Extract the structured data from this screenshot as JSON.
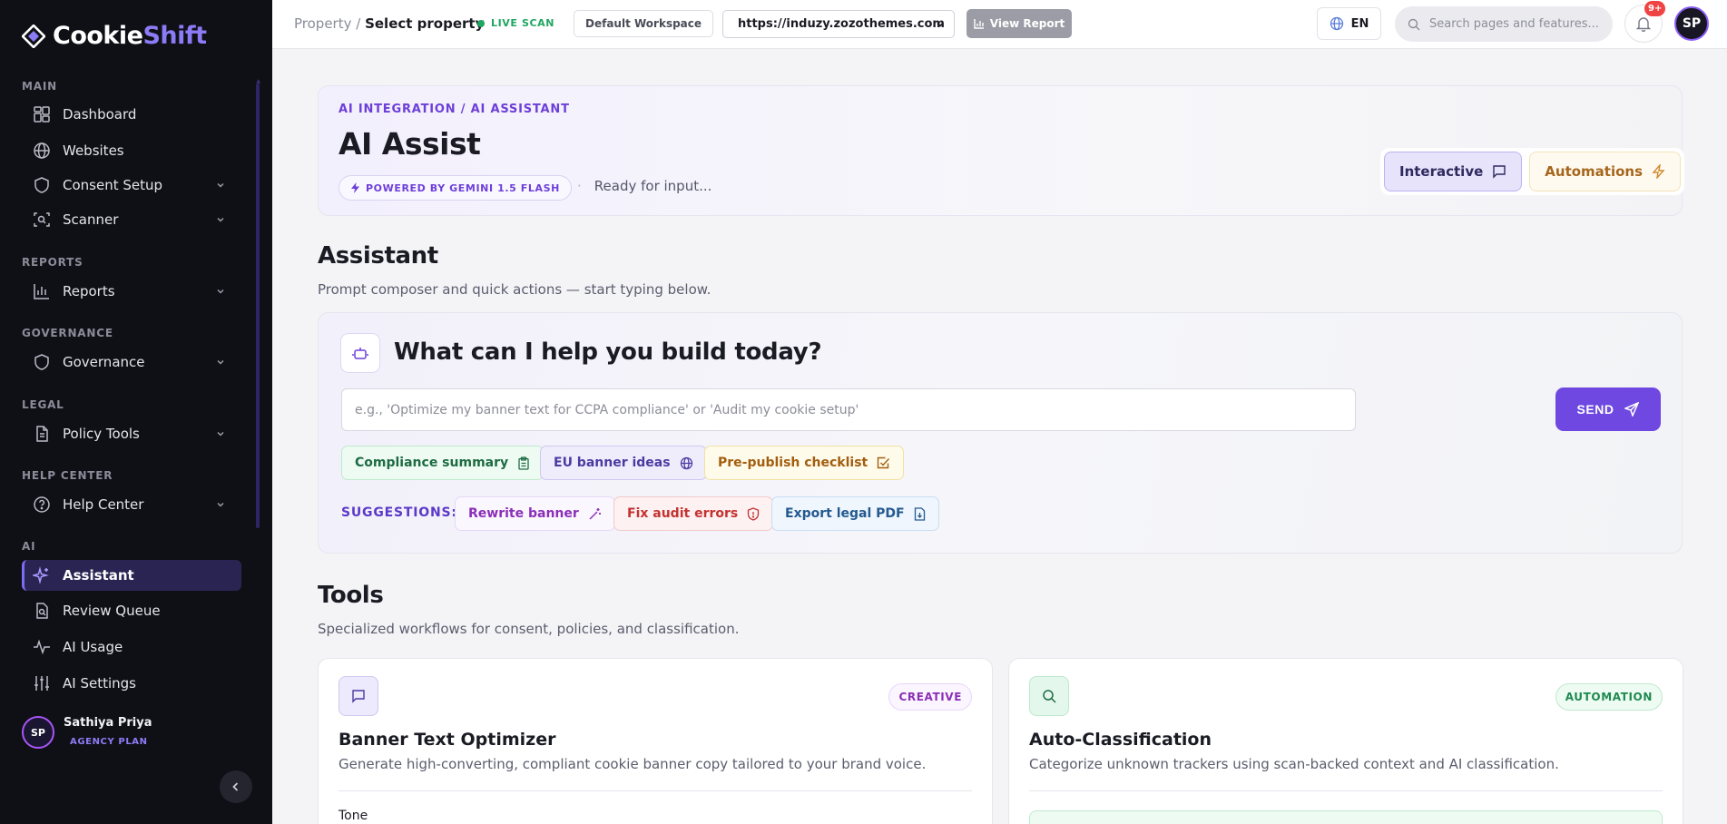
{
  "brand": {
    "name_part1": "Cookie",
    "name_part2": "Shift"
  },
  "sidebar": {
    "sections": {
      "main": "MAIN",
      "reports": "REPORTS",
      "governance": "GOVERNANCE",
      "legal": "LEGAL",
      "help": "HELP CENTER",
      "ai": "AI"
    },
    "items": [
      {
        "label": "Dashboard",
        "icon": "grid-icon"
      },
      {
        "label": "Websites",
        "icon": "globe-icon"
      },
      {
        "label": "Consent Setup",
        "icon": "shield-icon",
        "expandable": true
      },
      {
        "label": "Scanner",
        "icon": "scan-icon",
        "expandable": true
      },
      {
        "label": "Reports",
        "icon": "bar-chart-icon",
        "expandable": true
      },
      {
        "label": "Governance",
        "icon": "shield-icon",
        "expandable": true
      },
      {
        "label": "Policy Tools",
        "icon": "document-icon",
        "expandable": true
      },
      {
        "label": "Help Center",
        "icon": "help-circle-icon",
        "expandable": true
      },
      {
        "label": "Assistant",
        "icon": "sparkles-icon",
        "active": true
      },
      {
        "label": "Review Queue",
        "icon": "file-search-icon"
      },
      {
        "label": "AI Usage",
        "icon": "activity-icon"
      },
      {
        "label": "AI Settings",
        "icon": "sliders-icon"
      }
    ],
    "user": {
      "initials": "SP",
      "name": "Sathiya Priya",
      "plan": "AGENCY PLAN"
    }
  },
  "topbar": {
    "breadcrumb_prefix": "Property /",
    "breadcrumb_current": "Select property",
    "live_scan": "LIVE SCAN",
    "workspace": "Default Workspace",
    "url": "https://induzy.zozothemes.com",
    "view_report": "View Report",
    "language": "EN",
    "search_placeholder": "Search pages and features...",
    "notifications_badge": "9+",
    "avatar_initials": "SP"
  },
  "hero": {
    "breadcrumb": "AI INTEGRATION / AI ASSISTANT",
    "title": "AI Assist",
    "powered_by": "POWERED BY GEMINI 1.5 FLASH",
    "status": "Ready for input...",
    "modes": {
      "interactive": "Interactive",
      "automations": "Automations"
    }
  },
  "assistant": {
    "heading": "Assistant",
    "subheading": "Prompt composer and quick actions — start typing below.",
    "composer_title": "What can I help you build today?",
    "prompt_placeholder": "e.g., 'Optimize my banner text for CCPA compliance' or 'Audit my cookie setup'",
    "send_label": "SEND",
    "quick_actions": [
      "Compliance summary",
      "EU banner ideas",
      "Pre-publish checklist"
    ],
    "suggestions_label": "SUGGESTIONS:",
    "suggestions": [
      "Rewrite banner",
      "Fix audit errors",
      "Export legal PDF"
    ]
  },
  "tools": {
    "heading": "Tools",
    "subheading": "Specialized workflows for consent, policies, and classification.",
    "cards": [
      {
        "tag": "CREATIVE",
        "title": "Banner Text Optimizer",
        "description": "Generate high-converting, compliant cookie banner copy tailored to your brand voice.",
        "field_label": "Tone"
      },
      {
        "tag": "AUTOMATION",
        "title": "Auto-Classification",
        "description": "Categorize unknown trackers using scan-backed context and AI classification."
      }
    ]
  },
  "colors": {
    "accent": "#6e48e0",
    "sidebar_bg": "#0f1016",
    "live_green": "#1fa661",
    "badge_red": "#ef4444"
  }
}
